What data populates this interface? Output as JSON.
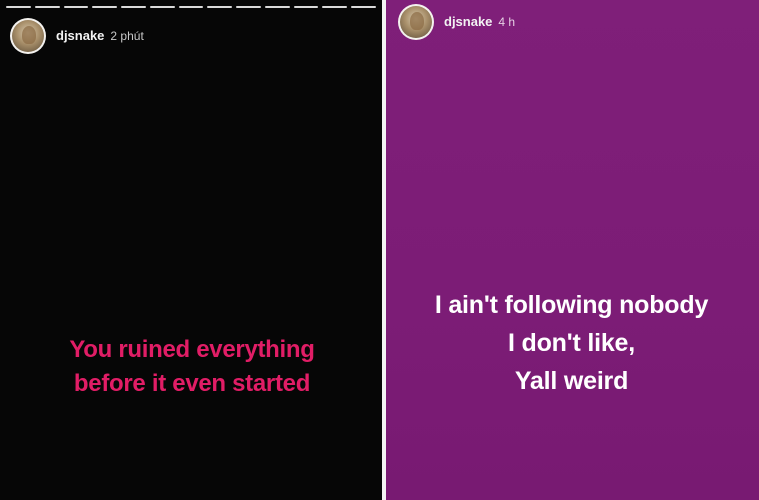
{
  "stories": [
    {
      "username": "djsnake",
      "time": "2 phút",
      "background": "#060606",
      "text_color": "#e11d66",
      "caption_lines": [
        "You ruined everything",
        "before it even started"
      ]
    },
    {
      "username": "djsnake",
      "time": "4 h",
      "background": "#7e1f78",
      "text_color": "#ffffff",
      "caption_lines": [
        "I ain't following nobody",
        "I don't like,",
        "Yall weird"
      ]
    }
  ]
}
